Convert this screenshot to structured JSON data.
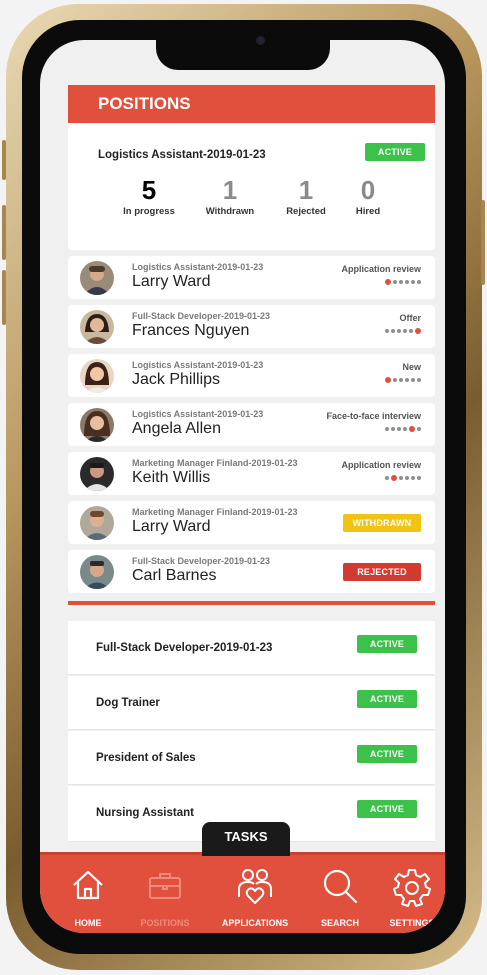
{
  "header": {
    "title": "POSITIONS"
  },
  "summary": {
    "title": "Logistics Assistant-2019-01-23",
    "status": "ACTIVE",
    "stats": [
      {
        "value": "5",
        "label": "In progress",
        "color": "#222222"
      },
      {
        "value": "1",
        "label": "Withdrawn",
        "color": "#8a8a8a"
      },
      {
        "value": "1",
        "label": "Rejected",
        "color": "#8a8a8a"
      },
      {
        "value": "0",
        "label": "Hired",
        "color": "#8a8a8a"
      }
    ]
  },
  "applications": [
    {
      "position": "Logistics Assistant-2019-01-23",
      "name": "Larry Ward",
      "stage": "Application review",
      "active_step": 1,
      "total_steps": 6
    },
    {
      "position": "Full-Stack Developer-2019-01-23",
      "name": "Frances Nguyen",
      "stage": "Offer",
      "active_step": 6,
      "total_steps": 6
    },
    {
      "position": "Logistics Assistant-2019-01-23",
      "name": "Jack Phillips",
      "stage": "New",
      "active_step": 1,
      "total_steps": 6
    },
    {
      "position": "Logistics Assistant-2019-01-23",
      "name": "Angela Allen",
      "stage": "Face-to-face interview",
      "active_step": 5,
      "total_steps": 6
    },
    {
      "position": "Marketing Manager Finland-2019-01-23",
      "name": "Keith Willis",
      "stage": "Application review",
      "active_step": 2,
      "total_steps": 6
    },
    {
      "position": "Marketing Manager Finland-2019-01-23",
      "name": "Larry Ward",
      "badge": "WITHDRAWN"
    },
    {
      "position": "Full-Stack Developer-2019-01-23",
      "name": "Carl Barnes",
      "badge": "REJECTED"
    }
  ],
  "positions": [
    {
      "title": "Full-Stack Developer-2019-01-23",
      "status": "ACTIVE"
    },
    {
      "title": "Dog Trainer",
      "status": "ACTIVE"
    },
    {
      "title": "President of Sales",
      "status": "ACTIVE"
    },
    {
      "title": "Nursing Assistant",
      "status": "ACTIVE"
    }
  ],
  "tasks": {
    "label": "TASKS"
  },
  "nav": [
    {
      "label": "HOME",
      "icon": "home-icon"
    },
    {
      "label": "POSITIONS",
      "icon": "briefcase-icon",
      "dim": true
    },
    {
      "label": "APPLICATIONS",
      "icon": "people-heart-icon"
    },
    {
      "label": "SEARCH",
      "icon": "search-icon"
    },
    {
      "label": "SETTINGS",
      "icon": "gear-icon"
    }
  ],
  "colors": {
    "accent": "#e0503d",
    "active": "#3cc24a",
    "withdrawn": "#f2c312",
    "rejected": "#d33a2f"
  }
}
